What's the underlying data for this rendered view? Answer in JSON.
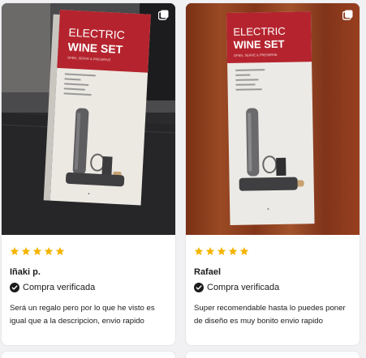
{
  "reviews": [
    {
      "rating": 5,
      "author": "Iñaki p.",
      "verified_label": "Compra verificada",
      "text": "Será un regalo pero por lo que he visto es igual que a la descripcion, envio rapido",
      "photo": {
        "title_line1": "ELECTRIC",
        "title_line2": "WINE SET",
        "tagline": "OPEN, SERVE & PRESERVE",
        "has_multiple_images": true
      }
    },
    {
      "rating": 5,
      "author": "Rafael",
      "verified_label": "Compra verificada",
      "text": "Super recomendable hasta lo puedes poner de diseño es muy bonito envio rapido",
      "photo": {
        "title_line1": "ELECTRIC",
        "title_line2": "WINE SET",
        "tagline": "OPEN, SERVE & PRESERVE",
        "has_multiple_images": true
      }
    }
  ],
  "colors": {
    "star": "#f5b400",
    "box_red": "#b5242e",
    "text": "#1b1b1b"
  },
  "icons": [
    "multiple-images-icon",
    "star-icon",
    "verified-check-icon"
  ]
}
